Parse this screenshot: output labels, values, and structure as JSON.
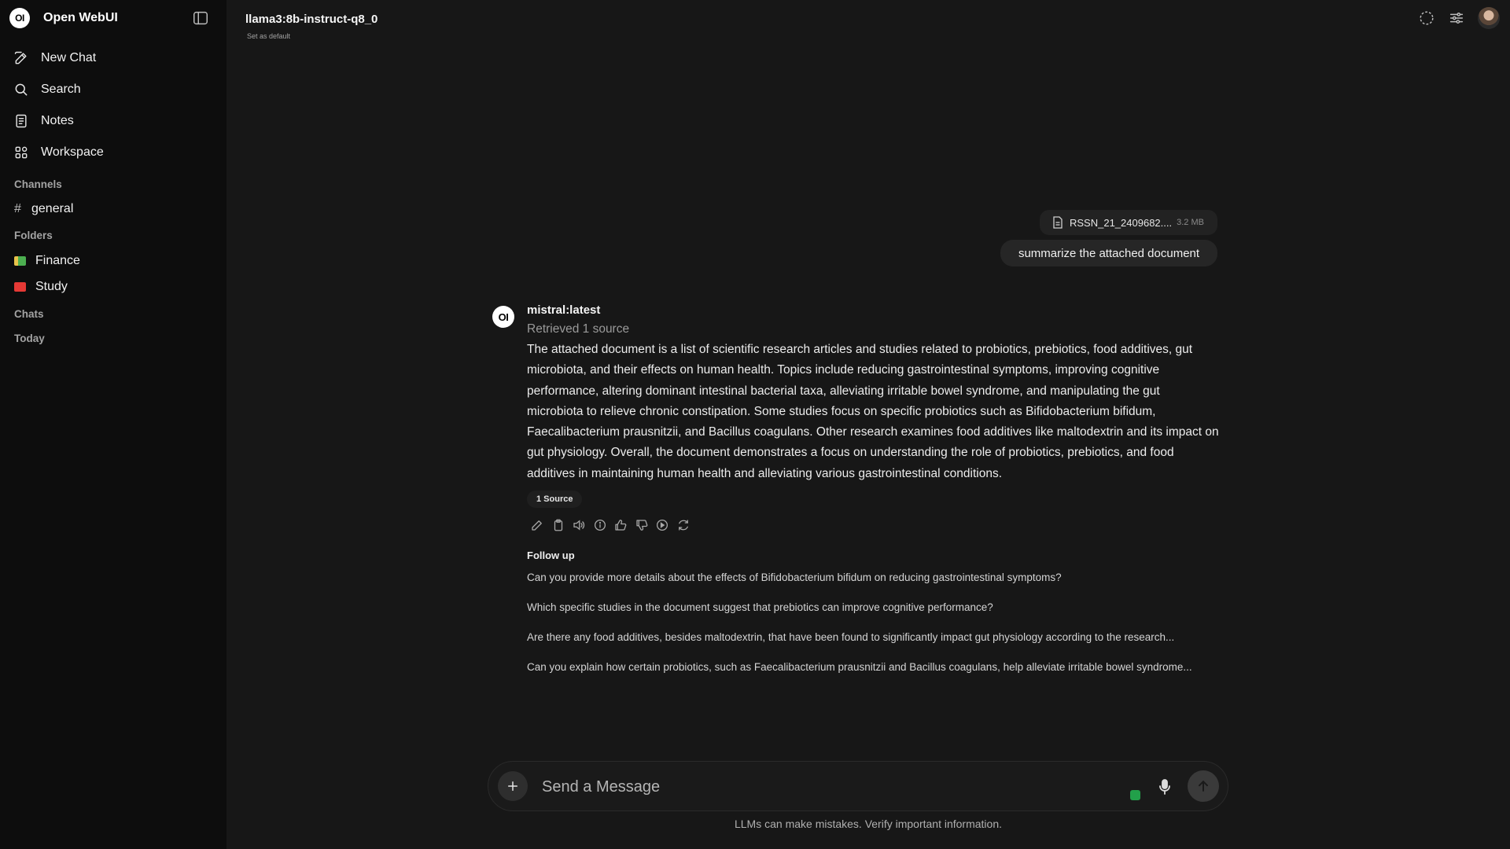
{
  "app": {
    "name": "Open WebUI",
    "logo_text": "OI"
  },
  "sidebar": {
    "nav": [
      {
        "label": "New Chat",
        "icon": "pencil-square-icon"
      },
      {
        "label": "Search",
        "icon": "search-icon"
      },
      {
        "label": "Notes",
        "icon": "notes-icon"
      },
      {
        "label": "Workspace",
        "icon": "grid-icon"
      }
    ],
    "channels_title": "Channels",
    "channels": [
      {
        "label": "general"
      }
    ],
    "folders_title": "Folders",
    "folders": [
      {
        "label": "Finance",
        "color": "#4caf50"
      },
      {
        "label": "Study",
        "color": "#e53935"
      }
    ],
    "chats_title": "Chats",
    "today_title": "Today"
  },
  "header": {
    "model": "llama3:8b-instruct-q8_0",
    "set_default": "Set as default"
  },
  "user_message": {
    "file_name": "RSSN_21_2409682....",
    "file_size": "3.2 MB",
    "text": "summarize the attached document"
  },
  "assistant": {
    "avatar_text": "OI",
    "model": "mistral:latest",
    "retrieved": "Retrieved 1 source",
    "response": "The attached document is a list of scientific research articles and studies related to probiotics, prebiotics, food additives, gut microbiota, and their effects on human health. Topics include reducing gastrointestinal symptoms, improving cognitive performance, altering dominant intestinal bacterial taxa, alleviating irritable bowel syndrome, and manipulating the gut microbiota to relieve chronic constipation. Some studies focus on specific probiotics such as Bifidobacterium bifidum, Faecalibacterium prausnitzii, and Bacillus coagulans. Other research examines food additives like maltodextrin and its impact on gut physiology. Overall, the document demonstrates a focus on understanding the role of probiotics, prebiotics, and food additives in maintaining human health and alleviating various gastrointestinal conditions.",
    "source_button": "1 Source",
    "followup_title": "Follow up",
    "followups": [
      "Can you provide more details about the effects of Bifidobacterium bifidum on reducing gastrointestinal symptoms?",
      "Which specific studies in the document suggest that prebiotics can improve cognitive performance?",
      "Are there any food additives, besides maltodextrin, that have been found to significantly impact gut physiology according to the research...",
      "Can you explain how certain probiotics, such as Faecalibacterium prausnitzii and Bacillus coagulans, help alleviate irritable bowel syndrome..."
    ]
  },
  "composer": {
    "placeholder": "Send a Message",
    "disclaimer": "LLMs can make mistakes. Verify important information."
  }
}
